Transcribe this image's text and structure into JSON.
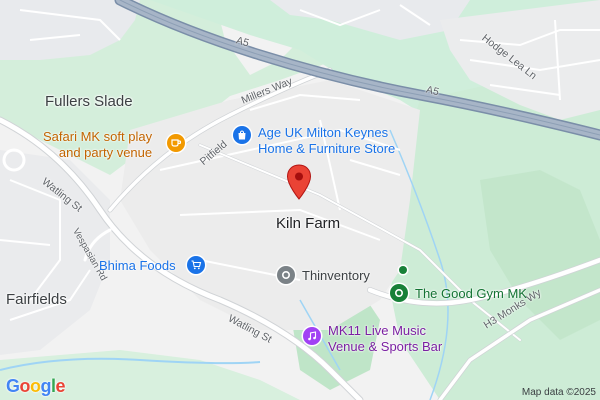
{
  "map": {
    "areas": {
      "fullers_slade": "Fullers Slade",
      "kiln_farm": "Kiln Farm",
      "fairfields": "Fairfields"
    },
    "roads": {
      "a5_top": "A5",
      "a5_right": "A5",
      "millers_way": "Millers Way",
      "pitfield": "Pitfield",
      "watling_st_upper": "Watling St",
      "watling_st_lower": "Watling St",
      "vespasian_rd": "Vespasian Rd",
      "hodge_lea_ln": "Hodge Lea Ln",
      "monks_wy": "H3 Monks Wy"
    },
    "pois": {
      "safari": {
        "line1": "Safari MK soft play",
        "line2": "and party venue",
        "icon": "cafe-icon",
        "color": "#f29900"
      },
      "age_uk": {
        "line1": "Age UK Milton Keynes",
        "line2": "Home & Furniture Store",
        "icon": "shopping-bag-icon",
        "color": "#1a73e8"
      },
      "bhima": {
        "line1": "Bhima Foods",
        "icon": "shopping-cart-icon",
        "color": "#1a73e8"
      },
      "thinventory": {
        "line1": "Thinventory",
        "icon": "circle-icon",
        "color": "#7b8287"
      },
      "good_gym": {
        "line1": "The Good Gym MK",
        "icon": "gym-icon",
        "color": "#188038"
      },
      "mk11": {
        "line1": "MK11 Live Music",
        "line2": "Venue & Sports Bar",
        "icon": "music-icon",
        "color": "#a142f4"
      }
    },
    "pin_color": "#ea4335",
    "attribution": "Map data ©2025",
    "logo": {
      "letters": [
        "G",
        "o",
        "o",
        "g",
        "l",
        "e"
      ],
      "colors": [
        "#4285f4",
        "#ea4335",
        "#fbbc05",
        "#4285f4",
        "#34a853",
        "#ea4335"
      ]
    }
  }
}
